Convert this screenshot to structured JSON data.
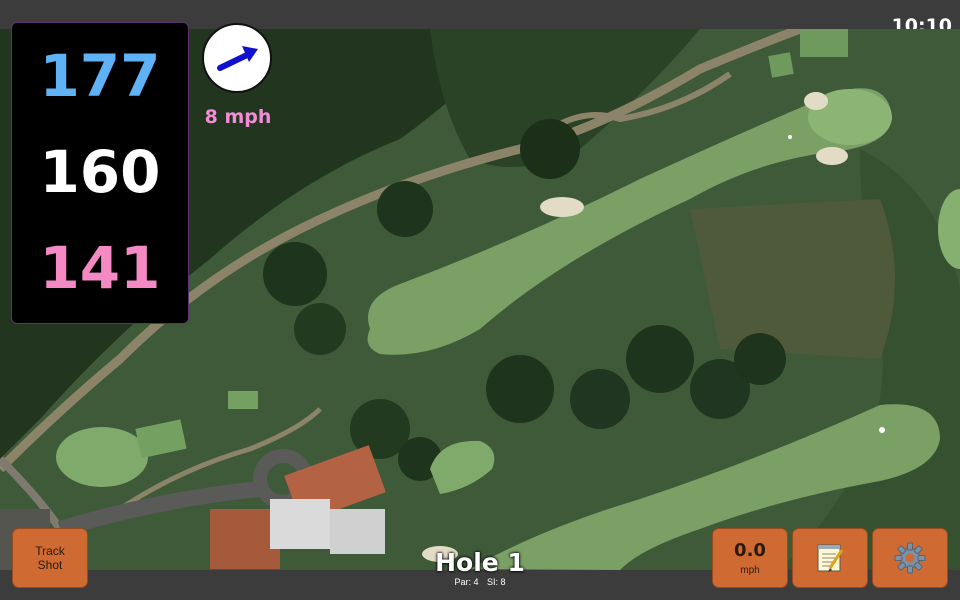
{
  "status_bar": {
    "time": "10:10"
  },
  "distances": {
    "back": "177",
    "middle": "160",
    "front": "141"
  },
  "wind": {
    "speed": "8 mph"
  },
  "hole": {
    "title": "Hole 1",
    "par": "Par: 4",
    "stroke_index": "SI: 8"
  },
  "buttons": {
    "track_shot": "Track\nShot",
    "speed_value": "0.0",
    "speed_unit": "mph"
  },
  "icons": {
    "wind": "wind-direction-arrow-icon",
    "notes": "notepad-icon",
    "settings": "gear-icon"
  },
  "colors": {
    "distance_back": "#5fb2f5",
    "distance_middle": "#ffffff",
    "distance_front": "#f489c4",
    "wind_speed": "#f28cd6",
    "button": "#cf6a33",
    "bar": "#3c3c3c"
  }
}
